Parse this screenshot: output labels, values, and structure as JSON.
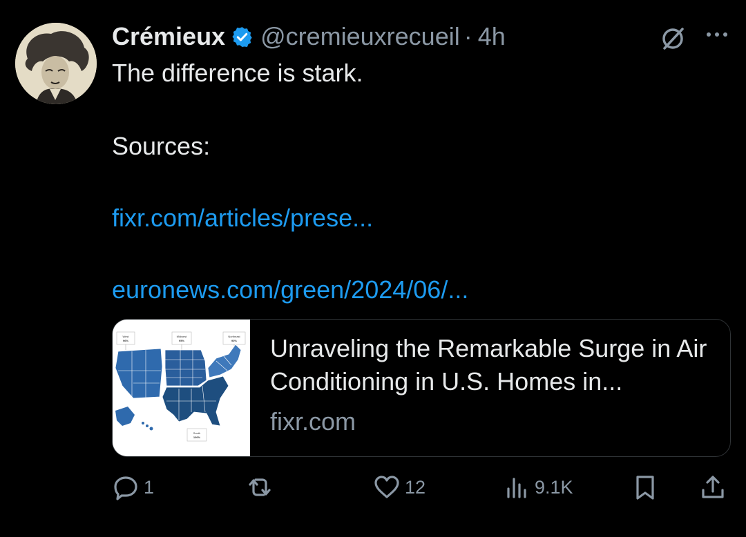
{
  "author": {
    "name": "Crémieux",
    "handle": "@cremieuxrecueil",
    "separator": "·",
    "time": "4h"
  },
  "icons": {
    "verified": "verified-badge-icon",
    "grok": "grok-icon",
    "more": "more-icon",
    "reply": "reply-icon",
    "retweet": "retweet-icon",
    "like": "like-icon",
    "views": "views-icon",
    "bookmark": "bookmark-icon",
    "share": "share-icon"
  },
  "tweet": {
    "line1": "The difference is stark.",
    "line2": "Sources:",
    "link1": "fixr.com/articles/prese...",
    "link2": "euronews.com/green/2024/06/..."
  },
  "card": {
    "title": "Unraveling the Remarkable Surge in Air Conditioning in U.S. Homes in...",
    "domain": "fixr.com",
    "map_labels": {
      "west": "West",
      "west_pct": "96%",
      "midwest": "Midwest",
      "midwest_pct": "95%",
      "northeast": "Northeast",
      "northeast_pct": "93%",
      "south": "South",
      "south_pct": "100%"
    }
  },
  "actions": {
    "replies": "1",
    "likes": "12",
    "views": "9.1K"
  },
  "colors": {
    "background": "#000000",
    "text": "#e7e9ea",
    "muted": "#8b98a5",
    "link": "#1d9bf0",
    "border": "#2f3336"
  }
}
